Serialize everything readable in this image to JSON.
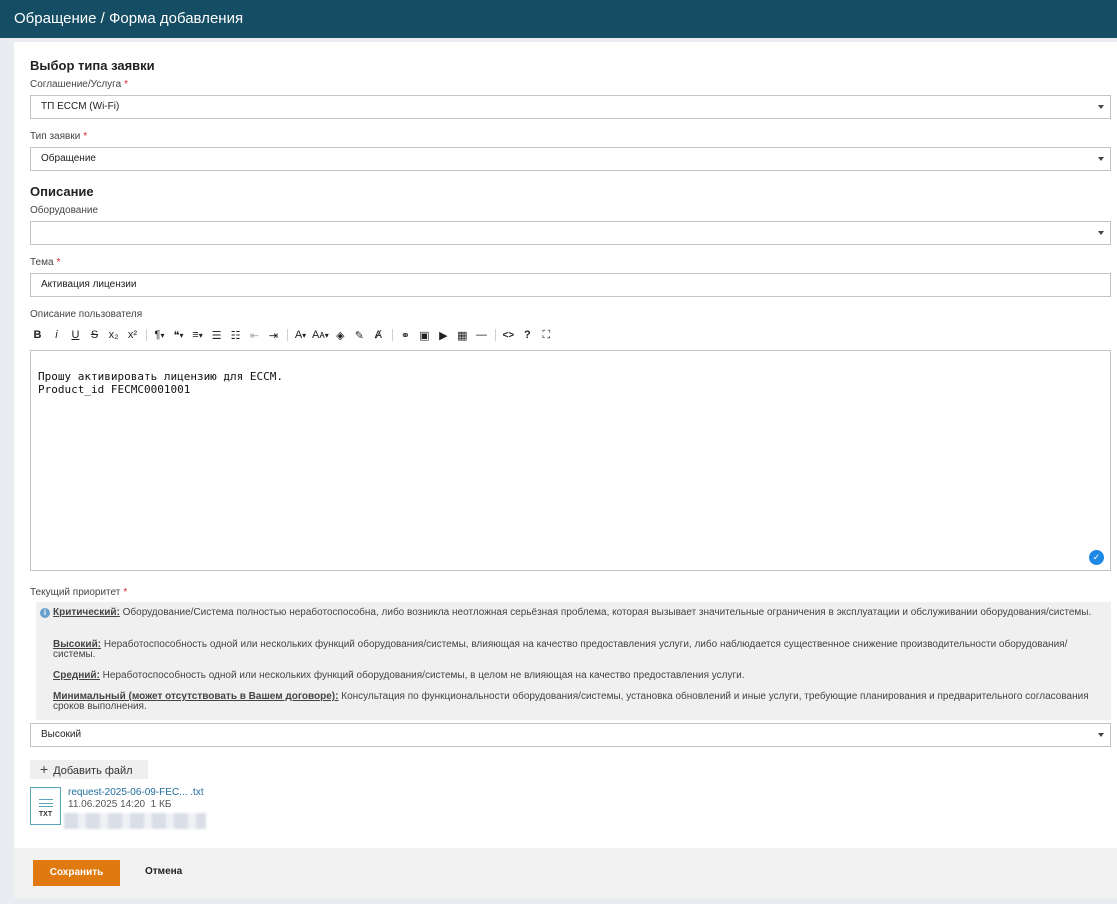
{
  "header": {
    "title": "Обращение / Форма добавления"
  },
  "type_section": {
    "title": "Выбор типа заявки",
    "agreement_label": "Соглашение/Услуга",
    "agreement_value": "ТП ECCM (Wi-Fi)",
    "request_type_label": "Тип заявки",
    "request_type_value": "Обращение"
  },
  "description_section": {
    "title": "Описание",
    "equipment_label": "Оборудование",
    "equipment_value": "",
    "subject_label": "Тема",
    "subject_value": "Активация лицензии",
    "user_desc_label": "Описание пользователя",
    "user_desc_line1": "Прошу активировать лицензию для ECCM.",
    "user_desc_line2": "Product_id FECMC0001001"
  },
  "toolbar": {
    "bold": "B",
    "italic": "i",
    "underline": "U",
    "strike": "S",
    "subscript": "x₂",
    "superscript": "x²",
    "paragraph": "¶",
    "quote": "❝",
    "align": "≡",
    "ol": "☰",
    "ul": "☷",
    "outdent": "⇤",
    "indent": "⇥",
    "font_color": "A",
    "font_size": "Aᴀ",
    "fill": "◈",
    "highlight": "✎",
    "clear": "Ⱥ",
    "link": "⚭",
    "image": "▣",
    "video": "▶",
    "table": "▦",
    "hr": "—",
    "code": "<>",
    "help": "?",
    "fullscreen": "⛶"
  },
  "priority": {
    "label": "Текущий приоритет",
    "items": [
      {
        "name": "Критический:",
        "text": " Оборудование/Система полностью неработоспособна, либо возникла неотложная серьёзная проблема, которая вызывает значительные ограничения в эксплуатации и обслуживании оборудования/системы."
      },
      {
        "name": "Высокий:",
        "text": " Неработоспособность одной или нескольких функций оборудования/системы, влияющая на качество предоставления услуги, либо наблюдается существенное снижение производительности оборудования/системы."
      },
      {
        "name": "Средний:",
        "text": " Неработоспособность одной или нескольких функций оборудования/системы, в целом не влияющая на качество предоставления услуги."
      },
      {
        "name": "Минимальный (может отсутствовать в Вашем договоре):",
        "text": " Консультация по функциональности оборудования/системы, установка обновлений и иные услуги, требующие планирования и предварительного согласования сроков выполнения."
      }
    ],
    "selected": "Высокий"
  },
  "files": {
    "add_label": "Добавить файл",
    "items": [
      {
        "name": "request-2025-06-09-FEC...  .txt",
        "ext": "TXT",
        "date": "11.06.2025  14:20",
        "size": "1 КБ"
      }
    ]
  },
  "footer": {
    "save_label": "Сохранить",
    "cancel_label": "Отмена"
  },
  "colors": {
    "header_bg": "#144d64",
    "accent": "#e07a10",
    "link": "#1f6d9e",
    "required": "#d9242c"
  },
  "icons": {
    "dropdown": "chevron-down-icon",
    "info": "info-icon",
    "check": "check-circle-icon",
    "add": "plus-icon",
    "file": "txt-file-icon"
  }
}
